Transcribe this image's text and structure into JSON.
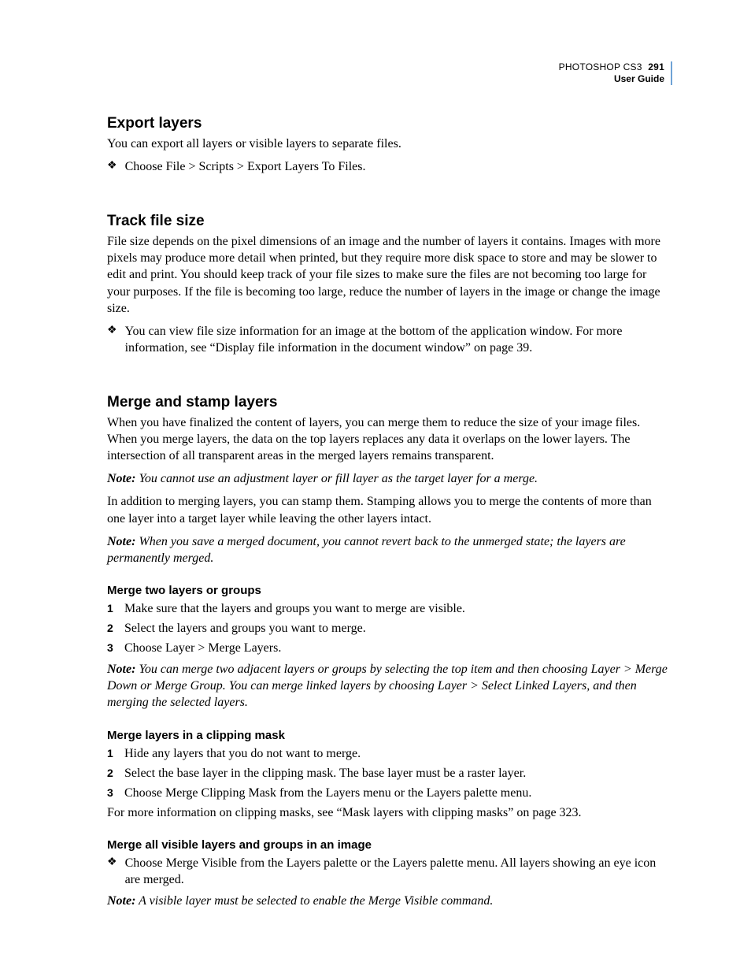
{
  "header": {
    "product": "PHOTOSHOP CS3",
    "page_number": "291",
    "doc_label": "User Guide"
  },
  "sections": {
    "export": {
      "heading": "Export layers",
      "body": "You can export all layers or visible layers to separate files.",
      "bullet": "Choose File > Scripts > Export Layers To Files."
    },
    "track": {
      "heading": "Track file size",
      "body": "File size depends on the pixel dimensions of an image and the number of layers it contains. Images with more pixels may produce more detail when printed, but they require more disk space to store and may be slower to edit and print. You should keep track of your file sizes to make sure the files are not becoming too large for your purposes. If the file is becoming too large, reduce the number of layers in the image or change the image size.",
      "bullet": "You can view file size information for an image at the bottom of the application window. For more information, see “Display file information in the document window” on page 39."
    },
    "merge": {
      "heading": "Merge and stamp layers",
      "p1": "When you have finalized the content of layers, you can merge them to reduce the size of your image files. When you merge layers, the data on the top layers replaces any data it overlaps on the lower layers. The intersection of all transparent areas in the merged layers remains transparent.",
      "note1_label": "Note:",
      "note1": "You cannot use an adjustment layer or fill layer as the target layer for a merge.",
      "p2": "In addition to merging layers, you can stamp them. Stamping allows you to merge the contents of more than one layer into a target layer while leaving the other layers intact.",
      "note2_label": "Note:",
      "note2": "When you save a merged document, you cannot revert back to the unmerged state; the layers are permanently merged.",
      "sub1_heading": "Merge two layers or groups",
      "sub1_steps": [
        "Make sure that the layers and groups you want to merge are visible.",
        "Select the layers and groups you want to merge.",
        "Choose Layer > Merge Layers."
      ],
      "sub1_note_label": "Note:",
      "sub1_note": "You can merge two adjacent layers or groups by selecting the top item and then choosing Layer > Merge Down or Merge Group. You can merge linked layers by choosing Layer > Select Linked Layers, and then merging the selected layers.",
      "sub2_heading": "Merge layers in a clipping mask",
      "sub2_steps": [
        "Hide any layers that you do not want to merge.",
        "Select the base layer in the clipping mask. The base layer must be a raster layer.",
        "Choose Merge Clipping Mask from the Layers menu or the Layers palette menu."
      ],
      "sub2_after": "For more information on clipping masks, see “Mask layers with clipping masks” on page 323.",
      "sub3_heading": "Merge all visible layers and groups in an image",
      "sub3_bullet": "Choose Merge Visible from the Layers palette or the Layers palette menu. All layers showing an eye icon are merged.",
      "sub3_note_label": "Note:",
      "sub3_note": "A visible layer must be selected to enable the Merge Visible command."
    }
  },
  "glyphs": {
    "bullet": "❖"
  },
  "numbers": {
    "one": "1",
    "two": "2",
    "three": "3"
  }
}
